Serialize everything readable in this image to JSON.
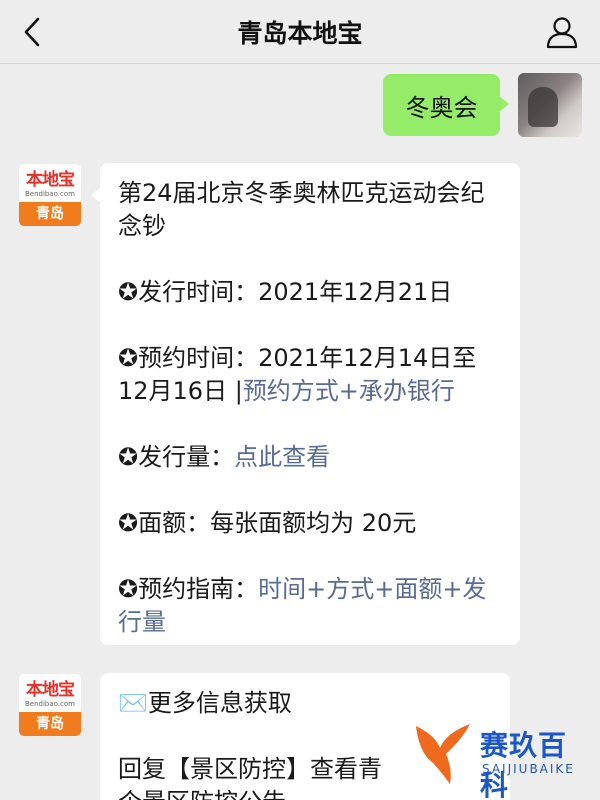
{
  "header": {
    "title": "青岛本地宝"
  },
  "colors": {
    "my_bubble": "#95ec69",
    "link": "#576b95",
    "brand_red": "#e4322b",
    "brand_orange": "#f07c1d"
  },
  "icons": {
    "back": "chevron-left-icon",
    "profile": "person-icon"
  },
  "sender_logo": {
    "main": "本地宝",
    "sub": "Bendibao.com",
    "city": "青岛"
  },
  "my_message": {
    "text": "冬奥会"
  },
  "reply1": {
    "title": "第24届北京冬季奥林匹克运动会纪念钞",
    "release_label": "✪发行时间：",
    "release_value": "2021年12月21日",
    "booking_label": "✪预约时间：",
    "booking_value": "2021年12月14日至12月16日",
    "booking_sep": "|",
    "booking_link": "预约方式+承办银行",
    "volume_label": "✪发行量：",
    "volume_link": "点此查看",
    "denom_label": "✪面额：",
    "denom_value": "每张面额均为 20元",
    "guide_label": "✪预约指南：",
    "guide_link": "时间+方式+面额+发行量"
  },
  "reply2": {
    "title": "✉️更多信息获取",
    "line": "回复【景区防控】查看青",
    "line_cut": "个景区防控公告"
  },
  "watermark": {
    "main": "赛玖百科",
    "sub": "SAIJIUBAIKE"
  }
}
